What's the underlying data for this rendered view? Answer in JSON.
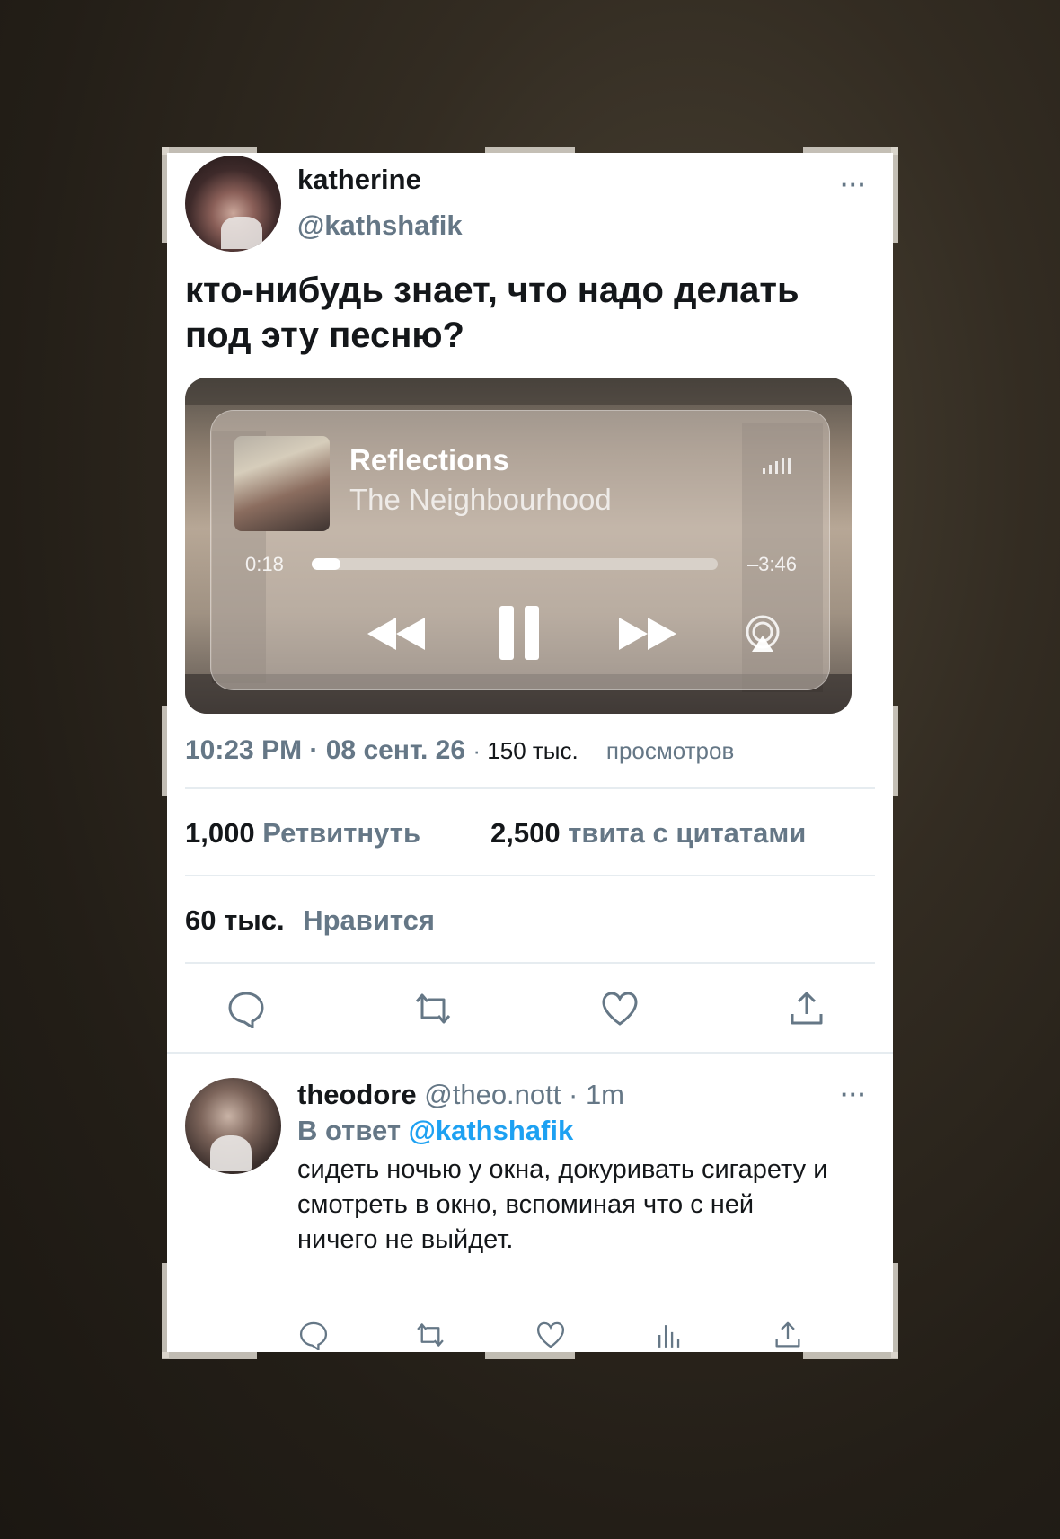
{
  "tweet": {
    "author_name": "katherine",
    "author_handle": "@kathshafik",
    "more_label": "···",
    "text": "кто-нибудь знает, что надо делать под эту песню?",
    "player": {
      "song_title": "Reflections",
      "artist": "The Neighbourhood",
      "elapsed": "0:18",
      "remaining": "–3:46",
      "progress_fraction": 0.07,
      "volume_icon": "volume-bars-icon"
    },
    "time": "10:23 PM",
    "date": "08 сент. 26",
    "views_count": "150 тыс.",
    "views_label": "просмотров",
    "retweets_count": "1,000",
    "retweets_label": "Ретвитнуть",
    "quotes_count": "2,500",
    "quotes_label": "твита с цитатами",
    "likes_count": "60 тыс.",
    "likes_label": "Нравится"
  },
  "reply": {
    "author_name": "theodore",
    "author_handle": "@theo.nott",
    "time_ago": "1m",
    "more_label": "···",
    "reply_prefix": "В ответ",
    "reply_to": "@kathshafik",
    "text": "сидеть ночью у окна, докуривать сигарету и смотреть в окно, вспоминая что с ней ничего не выйдет."
  },
  "colors": {
    "text_primary": "#14171a",
    "text_secondary": "#657786",
    "link": "#1da1f2",
    "divider": "#e6ecf0"
  },
  "icons": [
    "reply-icon",
    "retweet-icon",
    "like-icon",
    "share-icon",
    "analytics-icon",
    "rewind-icon",
    "pause-icon",
    "fast-forward-icon",
    "airplay-icon"
  ]
}
